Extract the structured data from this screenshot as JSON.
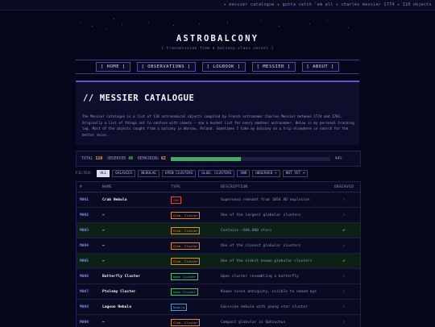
{
  "ticker": {
    "text": "✦ messier catalogue ✦ gotta catch 'em all ✦ charles messier 1774 ✦ 110 objects"
  },
  "stars": [
    "·",
    "·",
    "·",
    "·",
    "·",
    "·",
    "·",
    "·",
    "·",
    "·",
    "·",
    "·",
    "·",
    "·"
  ],
  "site": {
    "title": "ASTROBALCONY",
    "tagline": "[ transmission from a balcony-class vessel ]"
  },
  "nav": [
    "[ HOME ]",
    "[ OBSERVATIONS ]",
    "[ LOGBOOK ]",
    "[ MESSIER ]",
    "[ ABOUT ]"
  ],
  "panel": {
    "title": "// MESSIER CATALOGUE",
    "description": "The Messier Catalogue is a list of 110 astronomical objects compiled by French astronomer Charles Messier between 1774 and 1781. Originally a list of things not to confuse with comets — now a bucket list for every amateur astronomer. Below is my personal tracking log. Most of the objects caught from a balcony in Warsaw, Poland. Sometimes I take my balcony on a trip elsewhere in search for the better skies."
  },
  "stats": {
    "total_label": "TOTAL",
    "total": "110",
    "observed_label": "OBSERVED",
    "observed": "48",
    "remaining_label": "REMAINING",
    "remaining": "62",
    "progress": 0.44,
    "percent_label": "44%"
  },
  "filters": {
    "label": "FILTER:",
    "chips": [
      "ALL",
      "GALAXIES",
      "NEBULAE",
      "OPEN CLUSTERS",
      "GLOB. CLUSTERS",
      "SNR",
      "OBSERVED ▾",
      "NOT YET ▾"
    ],
    "active": 0
  },
  "table": {
    "headers": [
      "#",
      "NAME",
      "TYPE",
      "DESCRIPTION",
      "OBSERVED"
    ],
    "rows": [
      {
        "id": "M001",
        "name": "Crab Nebula",
        "type": "SNR",
        "desc": "Supernova remnant from 1054 AD explosion",
        "observed": false
      },
      {
        "id": "M002",
        "name": "—",
        "type": "Glob. Cluster",
        "desc": "One of the largest globular clusters",
        "observed": false
      },
      {
        "id": "M003",
        "name": "—",
        "type": "Glob. Cluster",
        "desc": "Contains ~500,000 stars",
        "observed": true
      },
      {
        "id": "M004",
        "name": "—",
        "type": "Glob. Cluster",
        "desc": "One of the closest globular clusters",
        "observed": false
      },
      {
        "id": "M005",
        "name": "—",
        "type": "Glob. Cluster",
        "desc": "One of the oldest known globular clusters",
        "observed": true
      },
      {
        "id": "M006",
        "name": "Butterfly Cluster",
        "type": "Open Cluster",
        "desc": "Open cluster resembling a butterfly",
        "observed": false
      },
      {
        "id": "M007",
        "name": "Ptolemy Cluster",
        "type": "Open Cluster",
        "desc": "Known since antiquity, visible to naked eye",
        "observed": false
      },
      {
        "id": "M008",
        "name": "Lagoon Nebula",
        "type": "Nebula",
        "desc": "Emission nebula with young star cluster",
        "observed": false
      },
      {
        "id": "M009",
        "name": "—",
        "type": "Glob. Cluster",
        "desc": "Compact globular in Ophiuchus",
        "observed": false
      }
    ],
    "mark_yes": "✔",
    "mark_no": "✕"
  },
  "type_colors": {
    "SNR": "#e0463c",
    "Glob. Cluster": "#e08a2a",
    "Open Cluster": "#46c85a",
    "Nebula": "#4a9ad8"
  }
}
